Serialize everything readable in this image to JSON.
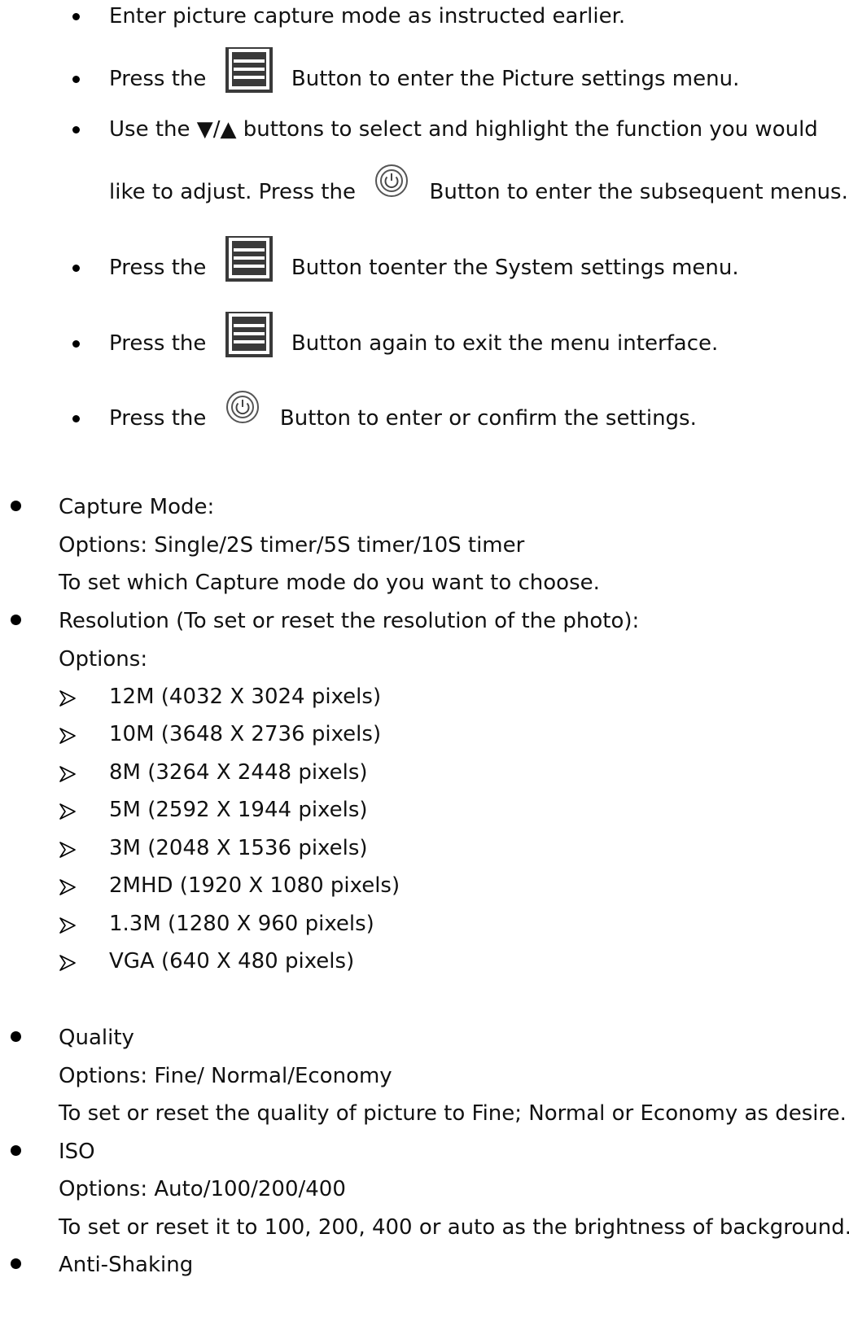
{
  "steps": [
    {
      "before": "Enter picture capture mode as instructed earlier.",
      "icon": "",
      "after": ""
    },
    {
      "before": "Press the",
      "icon": "menu-icon",
      "after": "Button to enter the Picture settings menu."
    },
    {
      "before": "Use the ▼/▲ buttons to select and highlight the function you would",
      "icon": "",
      "after": ""
    },
    {
      "before": "like to adjust. Press the",
      "icon": "power-icon",
      "after": "Button to enter the subsequent menus."
    },
    {
      "before": "Press the",
      "icon": "menu-icon",
      "after": "Button toenter the System settings menu."
    },
    {
      "before": "Press the",
      "icon": "menu-icon",
      "after": "Button again to exit the menu interface."
    },
    {
      "before": "Press the",
      "icon": "power-icon",
      "after": "Button to enter or confirm the settings."
    }
  ],
  "settings": {
    "capture_mode": {
      "title": "Capture Mode:",
      "options": "Options: Single/2S timer/5S timer/10S timer",
      "desc": "To set which Capture mode do you want to choose."
    },
    "resolution": {
      "title": "Resolution (To set or reset the resolution of the photo):",
      "options_label": "Options:",
      "options": [
        "12M (4032 X 3024 pixels)",
        "10M (3648 X 2736 pixels)",
        "8M (3264 X 2448 pixels)",
        "5M (2592 X 1944 pixels)",
        "3M (2048 X 1536 pixels)",
        "2MHD (1920 X 1080 pixels)",
        "1.3M (1280 X 960 pixels)",
        "VGA (640 X 480 pixels)"
      ]
    },
    "quality": {
      "title": "Quality",
      "options": "Options: Fine/ Normal/Economy",
      "desc": "To set or reset the quality of picture to Fine; Normal or Economy as desire."
    },
    "iso": {
      "title": "ISO",
      "options": "Options: Auto/100/200/400",
      "desc": "To set or reset it to 100, 200, 400 or auto as the brightness of background."
    },
    "anti_shaking": {
      "title": "Anti-Shaking"
    }
  }
}
